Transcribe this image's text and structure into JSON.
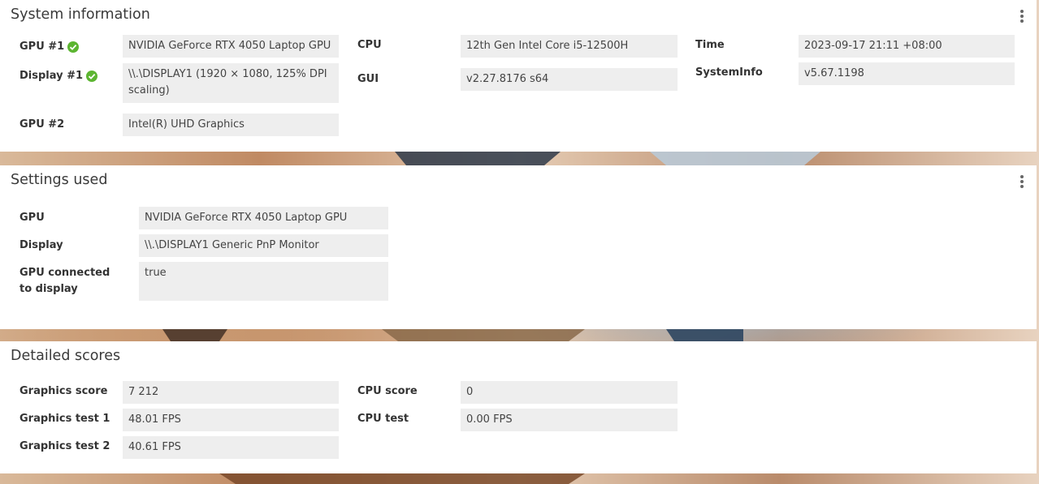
{
  "colors": {
    "panel_bg": "#ffffff",
    "value_bg": "#eeeeee",
    "check_green": "#5cb531"
  },
  "system_info": {
    "title": "System information",
    "gpu1": {
      "label": "GPU #1",
      "value": "NVIDIA GeForce RTX 4050 Laptop GPU",
      "status_icon": "check-circle-icon"
    },
    "display1": {
      "label": "Display #1",
      "value": "\\\\.\\DISPLAY1 (1920 × 1080, 125% DPI scaling)",
      "status_icon": "check-circle-icon"
    },
    "gpu2": {
      "label": "GPU #2",
      "value": "Intel(R) UHD Graphics"
    },
    "cpu": {
      "label": "CPU",
      "value": "12th Gen Intel Core i5-12500H"
    },
    "gui": {
      "label": "GUI",
      "value": "v2.27.8176 s64"
    },
    "time": {
      "label": "Time",
      "value": "2023-09-17 21:11 +08:00"
    },
    "systeminfo": {
      "label": "SystemInfo",
      "value": "v5.67.1198"
    }
  },
  "settings_used": {
    "title": "Settings used",
    "gpu": {
      "label": "GPU",
      "value": "NVIDIA GeForce RTX 4050 Laptop GPU"
    },
    "display": {
      "label": "Display",
      "value": "\\\\.\\DISPLAY1 Generic PnP Monitor"
    },
    "gpu_connected": {
      "label": "GPU connected to display",
      "value": "true"
    }
  },
  "detailed_scores": {
    "title": "Detailed scores",
    "graphics_score": {
      "label": "Graphics score",
      "value": "7 212"
    },
    "graphics_test1": {
      "label": "Graphics test 1",
      "value": "48.01 FPS"
    },
    "graphics_test2": {
      "label": "Graphics test 2",
      "value": "40.61 FPS"
    },
    "cpu_score": {
      "label": "CPU score",
      "value": "0"
    },
    "cpu_test": {
      "label": "CPU test",
      "value": "0.00 FPS"
    }
  }
}
